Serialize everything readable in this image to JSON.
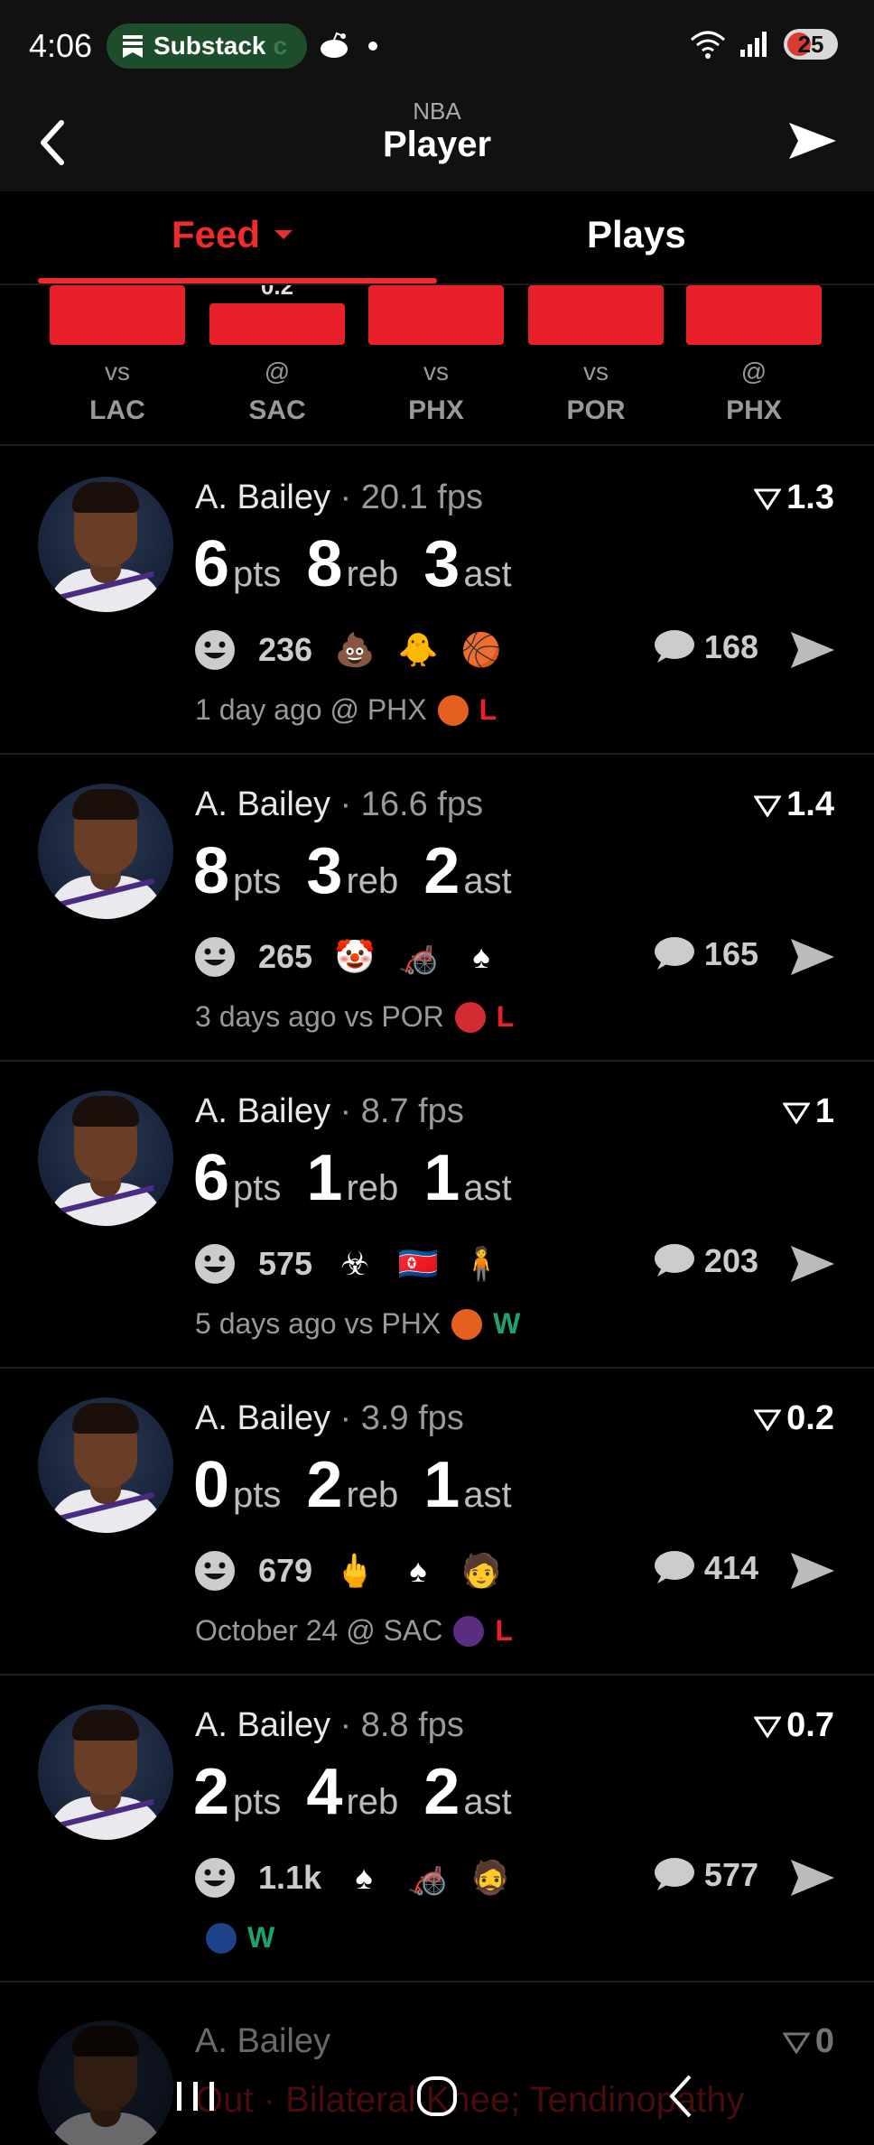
{
  "status_bar": {
    "time": "4:06",
    "notification_app": "Substack",
    "notification_fade": "c",
    "battery": "25"
  },
  "header": {
    "league": "NBA",
    "title": "Player"
  },
  "tabs": {
    "feed": "Feed",
    "plays": "Plays"
  },
  "game_strip": [
    {
      "value": "",
      "loc": "vs",
      "opp": "LAC",
      "level": 0.6
    },
    {
      "value": "0.2",
      "loc": "@",
      "opp": "SAC",
      "level": 0.42
    },
    {
      "value": "",
      "loc": "vs",
      "opp": "PHX",
      "level": 0.6
    },
    {
      "value": "",
      "loc": "vs",
      "opp": "POR",
      "level": 0.6
    },
    {
      "value": "",
      "loc": "@",
      "opp": "PHX",
      "level": 0.6
    }
  ],
  "units": {
    "pts": "pts",
    "reb": "reb",
    "ast": "ast"
  },
  "cards": [
    {
      "name": "A. Bailey",
      "fps": "· 20.1 fps",
      "rating": "1.3",
      "pts": "6",
      "reb": "8",
      "ast": "3",
      "react_count": "236",
      "emojis": [
        "💩",
        "🐥",
        "🏀"
      ],
      "comments": "168",
      "when": "1 day ago @ PHX",
      "team_color": "#e56020",
      "result": "L"
    },
    {
      "name": "A. Bailey",
      "fps": "· 16.6 fps",
      "rating": "1.4",
      "pts": "8",
      "reb": "3",
      "ast": "2",
      "react_count": "265",
      "emojis": [
        "🤡",
        "🦽",
        "♠"
      ],
      "comments": "165",
      "when": "3 days ago vs POR",
      "team_color": "#d42b32",
      "result": "L"
    },
    {
      "name": "A. Bailey",
      "fps": "· 8.7 fps",
      "rating": "1",
      "pts": "6",
      "reb": "1",
      "ast": "1",
      "react_count": "575",
      "emojis": [
        "☣",
        "🇰🇵",
        "🧍"
      ],
      "comments": "203",
      "when": "5 days ago vs PHX",
      "team_color": "#e56020",
      "result": "W"
    },
    {
      "name": "A. Bailey",
      "fps": "· 3.9 fps",
      "rating": "0.2",
      "pts": "0",
      "reb": "2",
      "ast": "1",
      "react_count": "679",
      "emojis": [
        "🖕",
        "♠",
        "🧑"
      ],
      "comments": "414",
      "when": "October 24 @ SAC",
      "team_color": "#5a2d81",
      "result": "L"
    },
    {
      "name": "A. Bailey",
      "fps": "· 8.8 fps",
      "rating": "0.7",
      "pts": "2",
      "reb": "4",
      "ast": "2",
      "react_count": "1.1k",
      "emojis": [
        "♠",
        "🦽",
        "🧔"
      ],
      "comments": "577",
      "when": "",
      "team_color": "#1d428a",
      "result": "W"
    }
  ],
  "partial_card": {
    "name": "A. Bailey",
    "rating": "0",
    "injury": "Out · Bilateral Knee; Tendinopathy"
  },
  "colors": {
    "accent": "#ef2b2d",
    "win": "#1ea36b",
    "loss": "#e8202a"
  }
}
